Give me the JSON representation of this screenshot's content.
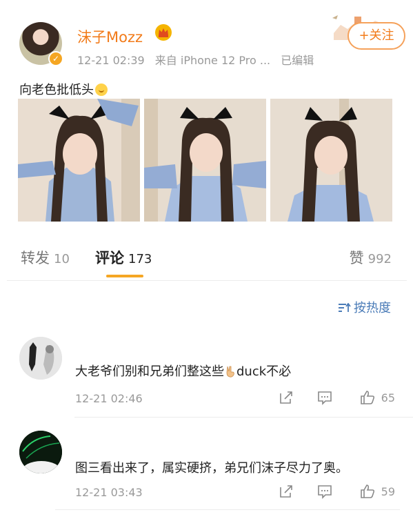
{
  "post": {
    "username": "沫子Mozz",
    "time": "12-21 02:39",
    "source": "来自 iPhone 12 Pro ...",
    "edited": "已编辑",
    "follow_label": "+关注",
    "text": "向老色批低头"
  },
  "tabs": {
    "forward_label": "转发",
    "forward_count": "10",
    "comments_label": "评论",
    "comments_count": "173",
    "likes_label": "赞",
    "likes_count": "992"
  },
  "sort_label": "按热度",
  "comments": [
    {
      "text_before": "大老爷们别和兄弟们整这些",
      "text_after": "duck不必",
      "time": "12-21 02:46",
      "likes": "65"
    },
    {
      "text": "图三看出来了，属实硬挤，弟兄们沫子尽力了奥。",
      "time": "12-21 03:43",
      "likes": "59"
    }
  ],
  "colors": {
    "accent": "#f27b1a",
    "link": "#4a7bb7",
    "underline": "#f5a623"
  },
  "icons": [
    "crown-icon",
    "verified-icon",
    "share-icon",
    "reply-icon",
    "like-icon",
    "sort-icon",
    "victory-hand-emoji"
  ]
}
